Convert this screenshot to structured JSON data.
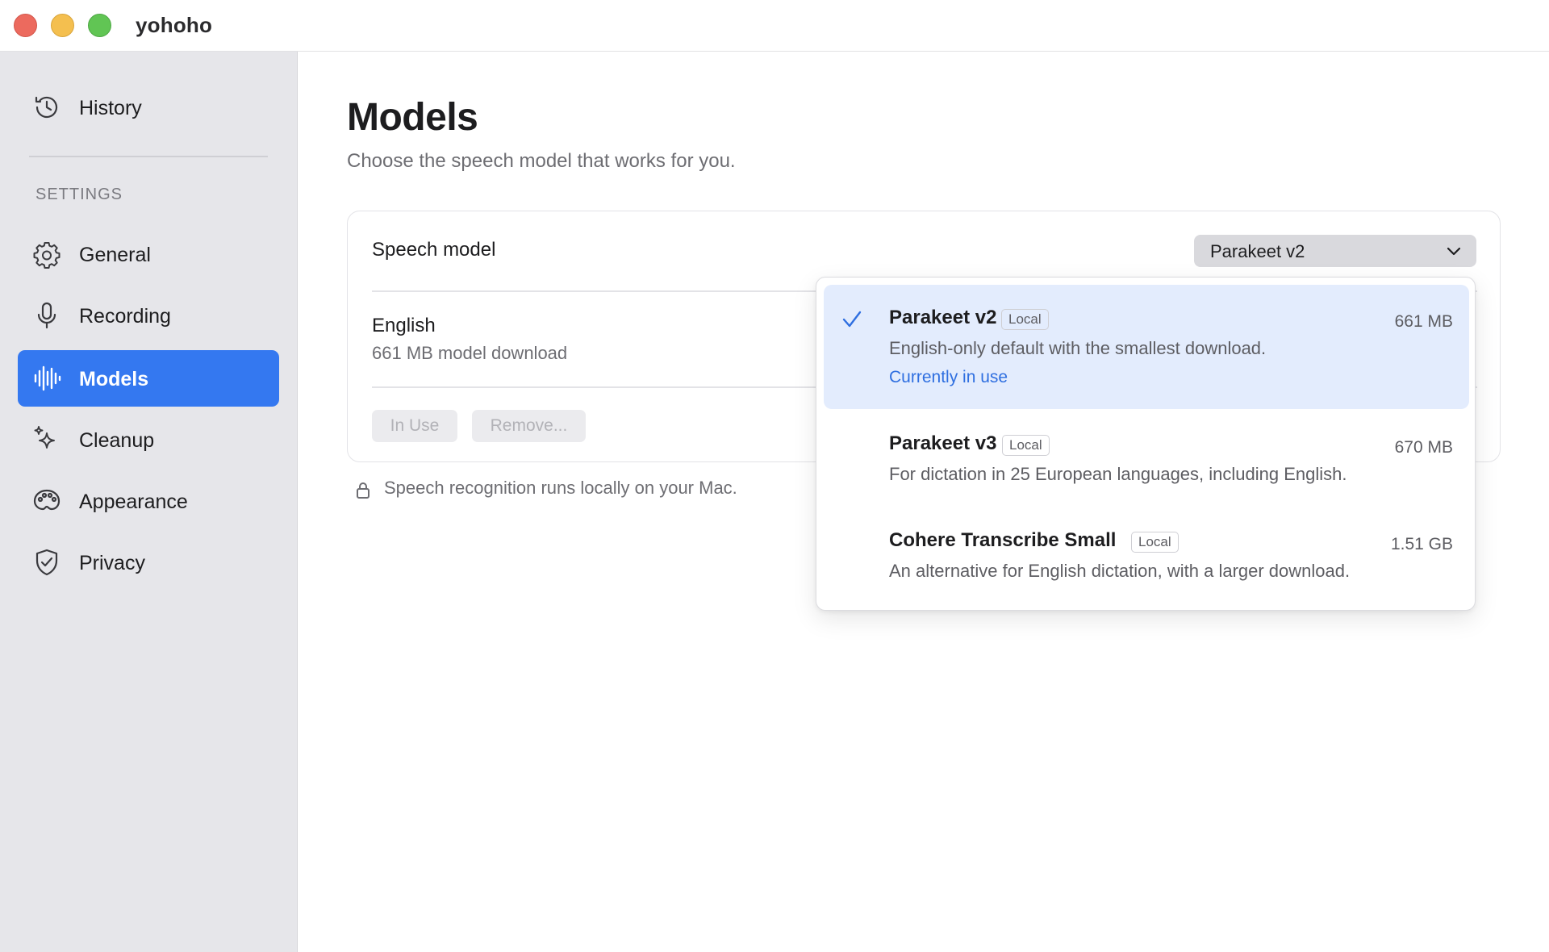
{
  "window": {
    "app_title": "yohoho"
  },
  "sidebar": {
    "history": {
      "label": "History",
      "icon": "history-icon"
    },
    "section_label": "SETTINGS",
    "items": [
      {
        "label": "General",
        "icon": "gear-icon",
        "active": false
      },
      {
        "label": "Recording",
        "icon": "microphone-icon",
        "active": false
      },
      {
        "label": "Models",
        "icon": "waveform-icon",
        "active": true
      },
      {
        "label": "Cleanup",
        "icon": "sparkles-icon",
        "active": false
      },
      {
        "label": "Appearance",
        "icon": "palette-icon",
        "active": false
      },
      {
        "label": "Privacy",
        "icon": "shield-check-icon",
        "active": false
      }
    ],
    "accent_color": "#3478f0"
  },
  "main": {
    "title": "Models",
    "subtitle": "Choose the speech model that works for you.",
    "card": {
      "speech_model_label": "Speech model",
      "selected_model": "Parakeet v2",
      "language": "English",
      "download_info": "661 MB model download",
      "in_use_button": "In Use",
      "remove_button": "Remove..."
    },
    "footnote": "Speech recognition runs locally on your Mac."
  },
  "model_menu": {
    "options": [
      {
        "name": "Parakeet v2",
        "badge": "Local",
        "size": "661 MB",
        "description": "English-only default with the smallest download.",
        "status": "Currently in use",
        "selected": true
      },
      {
        "name": "Parakeet v3",
        "badge": "Local",
        "size": "670 MB",
        "description": "For dictation in 25 European languages, including English.",
        "selected": false
      },
      {
        "name": "Cohere Transcribe Small",
        "badge": "Local",
        "size": "1.51 GB",
        "description": "An alternative for English dictation, with a larger download.",
        "selected": false
      }
    ],
    "selected_highlight_color": "#e3ecfd",
    "status_color": "#2f6fe0"
  }
}
